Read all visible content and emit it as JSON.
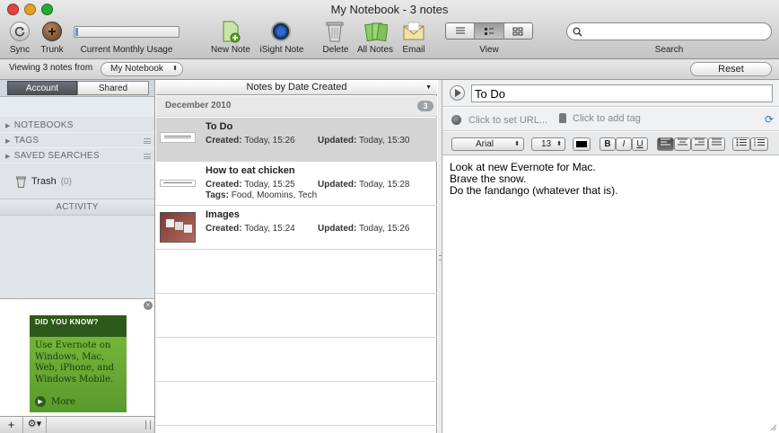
{
  "window": {
    "title": "My Notebook - 3 notes"
  },
  "toolbar": {
    "sync": "Sync",
    "trunk": "Trunk",
    "usage": "Current Monthly Usage",
    "new_note": "New Note",
    "isight": "iSight Note",
    "delete": "Delete",
    "all_notes": "All Notes",
    "email": "Email",
    "view": "View",
    "search": "Search",
    "search_placeholder": ""
  },
  "subbar": {
    "viewing": "Viewing 3 notes from",
    "notebook": "My Notebook",
    "reset": "Reset"
  },
  "sidebar": {
    "tabs": [
      "Account",
      "Shared"
    ],
    "sections": [
      "NOTEBOOKS",
      "TAGS",
      "SAVED SEARCHES"
    ],
    "trash": "Trash",
    "trash_count": "(0)",
    "activity": "ACTIVITY",
    "ad": {
      "heading": "DID YOU KNOW?",
      "body": "Use Evernote on Windows, Mac, Web, iPhone, and Windows Mobile.",
      "more": "More"
    }
  },
  "notelist": {
    "sort": "Notes by Date Created",
    "group": "December 2010",
    "group_count": "3",
    "created_label": "Created:",
    "updated_label": "Updated:",
    "tags_label": "Tags:",
    "notes": [
      {
        "title": "To Do",
        "created": "Today, 15:26",
        "updated": "Today, 15:30",
        "tags": ""
      },
      {
        "title": "How to eat chicken",
        "created": "Today, 15:25",
        "updated": "Today, 15:28",
        "tags": "Food, Moomins, Tech"
      },
      {
        "title": "Images",
        "created": "Today, 15:24",
        "updated": "Today, 15:26",
        "tags": ""
      }
    ]
  },
  "editor": {
    "title": "To Do",
    "url_placeholder": "Click to set URL...",
    "tag_placeholder": "Click to add tag",
    "font": "Arial",
    "size": "13",
    "bold": "B",
    "italic": "I",
    "underline": "U",
    "lines": [
      "Look at new Evernote for Mac.",
      "Brave the snow.",
      "Do the fandango (whatever that is)."
    ]
  },
  "colors": {
    "accent": "#3875d7",
    "selected_row": "#d4d4d4",
    "ad_green": "#5a9a2e"
  }
}
